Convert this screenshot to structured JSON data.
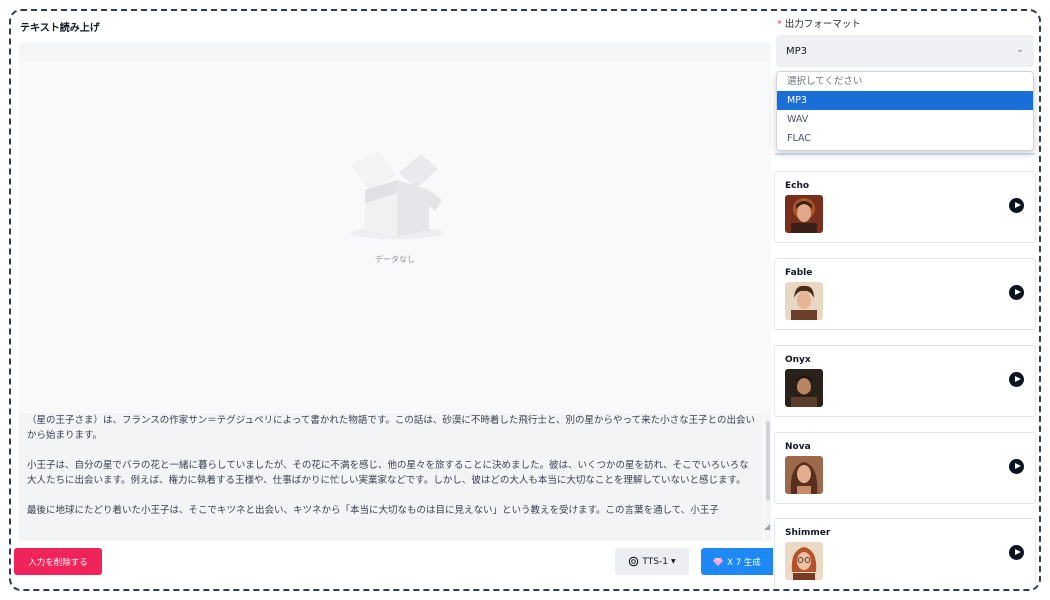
{
  "header": {
    "title": "テキスト読み上げ"
  },
  "preview": {
    "empty_text": "データなし"
  },
  "text_input": {
    "paragraphs": [
      "（星の王子さま）は、フランスの作家サン＝テグジュペリによって書かれた物語です。この話は、砂漠に不時着した飛行士と、別の星からやって来た小さな王子との出会いから始まります。",
      "小王子は、自分の星でバラの花と一緒に暮らしていましたが、その花に不満を感じ、他の星々を旅することに決めました。彼は、いくつかの星を訪れ、そこでいろいろな大人たちに出会います。例えば、権力に執着する王様や、仕事ばかりに忙しい実業家などです。しかし、彼はどの大人も本当に大切なことを理解していないと感じます。",
      "最後に地球にたどり着いた小王子は、そこでキツネと出会い、キツネから「本当に大切なものは目に見えない」という教えを受けます。この言葉を通して、小王子"
    ]
  },
  "actions": {
    "delete_label": "入力を削除する",
    "model_label": "TTS-1",
    "generate_label": "X 7 生成"
  },
  "format": {
    "label": "出力フォーマット",
    "required_mark": "*",
    "selected": "MP3",
    "options": [
      "選択してください",
      "MP3",
      "WAV",
      "FLAC"
    ]
  },
  "voices": [
    {
      "name": "Echo"
    },
    {
      "name": "Fable"
    },
    {
      "name": "Onyx"
    },
    {
      "name": "Nova"
    },
    {
      "name": "Shimmer"
    }
  ],
  "colors": {
    "delete": "#f0245a",
    "generate": "#1e88f5",
    "selected_option": "#1a6ed8",
    "frame_border": "#2b3a55"
  }
}
